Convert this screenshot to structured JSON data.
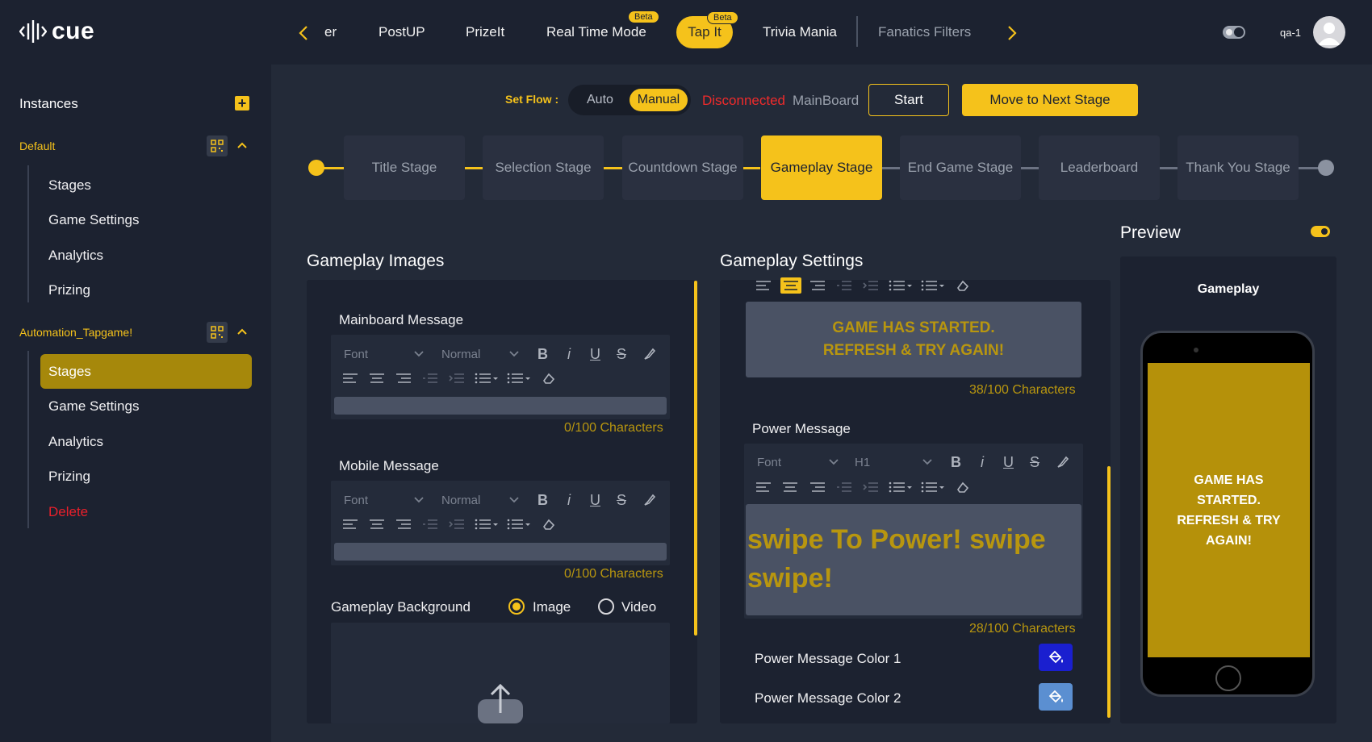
{
  "app": {
    "logo_text": "cue"
  },
  "nav": {
    "tabs": [
      "er",
      "PostUP",
      "PrizeIt",
      "Real Time Mode",
      "Tap It",
      "Trivia Mania",
      "Fanatics Filters"
    ],
    "beta_label": "Beta",
    "user": "qa-1"
  },
  "sidebar": {
    "heading": "Instances",
    "groups": [
      {
        "name": "Default",
        "items": [
          "Stages",
          "Game Settings",
          "Analytics",
          "Prizing"
        ]
      },
      {
        "name": "Automation_Tapgame!",
        "items": [
          "Stages",
          "Game Settings",
          "Analytics",
          "Prizing",
          "Delete"
        ]
      }
    ]
  },
  "flow": {
    "label": "Set Flow :",
    "auto": "Auto",
    "manual": "Manual",
    "status": "Disconnected",
    "board": "MainBoard",
    "start": "Start",
    "next": "Move to Next Stage"
  },
  "stages": [
    "Title Stage",
    "Selection Stage",
    "Countdown Stage",
    "Gameplay Stage",
    "End Game Stage",
    "Leaderboard",
    "Thank You Stage"
  ],
  "images": {
    "title": "Gameplay Images",
    "mainboard_label": "Mainboard Message",
    "mobile_label": "Mobile Message",
    "font": "Font",
    "size": "Normal",
    "mainboard_chars": "0/100 Characters",
    "mobile_chars": "0/100 Characters",
    "background_label": "Gameplay Background",
    "opt_image": "Image",
    "opt_video": "Video"
  },
  "settings": {
    "title": "Gameplay Settings",
    "top_message_line1": "GAME HAS STARTED.",
    "top_message_line2": "REFRESH & TRY AGAIN!",
    "top_chars": "38/100 Characters",
    "power_label": "Power Message",
    "font": "Font",
    "size": "H1",
    "power_text": "swipe To Power! swipe swipe!",
    "power_chars": "28/100 Characters",
    "color1_label": "Power Message Color 1",
    "color2_label": "Power Message Color 2",
    "color1": "#1a1fcf",
    "color2": "#5b8fd1"
  },
  "preview": {
    "title": "Preview",
    "screen_label": "Gameplay",
    "phone_text": "GAME HAS STARTED. REFRESH & TRY AGAIN!"
  }
}
